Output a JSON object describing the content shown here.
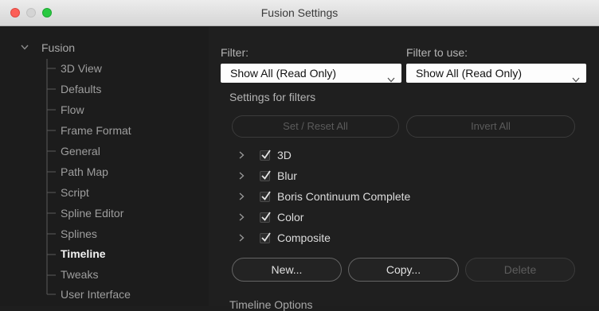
{
  "window": {
    "title": "Fusion Settings"
  },
  "sidebar": {
    "root": {
      "label": "Fusion",
      "icon": "chevron-down-icon"
    },
    "items": [
      {
        "label": "3D View"
      },
      {
        "label": "Defaults"
      },
      {
        "label": "Flow"
      },
      {
        "label": "Frame Format"
      },
      {
        "label": "General"
      },
      {
        "label": "Path Map"
      },
      {
        "label": "Script"
      },
      {
        "label": "Spline Editor"
      },
      {
        "label": "Splines"
      },
      {
        "label": "Timeline",
        "active": true
      },
      {
        "label": "Tweaks"
      },
      {
        "label": "User Interface"
      }
    ]
  },
  "main": {
    "filter_label": "Filter:",
    "filter_value": "Show All (Read Only)",
    "filter_to_use_label": "Filter to use:",
    "filter_to_use_value": "Show All (Read Only)",
    "settings_for_filters_label": "Settings for filters",
    "set_reset_all_label": "Set / Reset All",
    "invert_all_label": "Invert All",
    "filters": [
      {
        "name": "3D",
        "checked": true
      },
      {
        "name": "Blur",
        "checked": true
      },
      {
        "name": "Boris Continuum Complete",
        "checked": true
      },
      {
        "name": "Color",
        "checked": true
      },
      {
        "name": "Composite",
        "checked": true
      }
    ],
    "new_label": "New...",
    "copy_label": "Copy...",
    "delete_label": "Delete",
    "timeline_options_label": "Timeline Options"
  },
  "colors": {
    "background": "#1e1e1e",
    "active_text": "#f2f2f2",
    "dropdown_bg": "#fdfdfd",
    "close": "#fc5f57",
    "maximize": "#29c940"
  }
}
